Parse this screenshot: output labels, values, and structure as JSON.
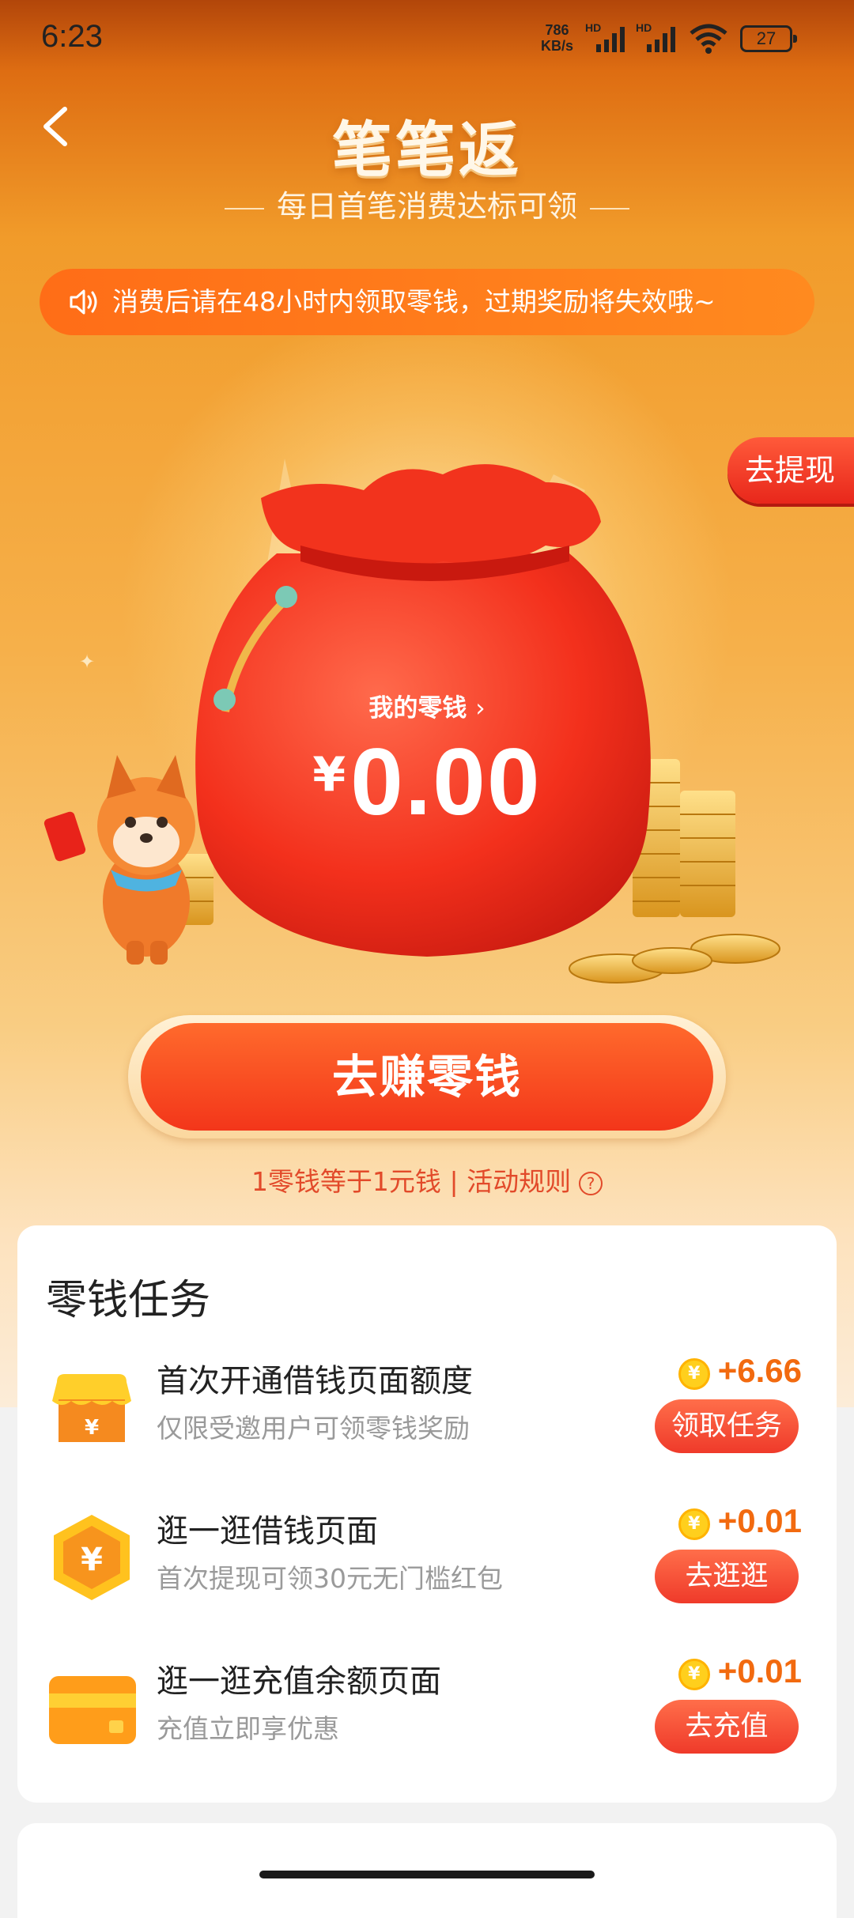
{
  "status_bar": {
    "time": "6:23",
    "net_speed": "786",
    "net_unit": "KB/s",
    "hd1": "HD",
    "hd2": "HD",
    "battery": "27"
  },
  "header": {
    "title": "笔笔返",
    "subtitle": "每日首笔消费达标可领"
  },
  "notice": {
    "text": "消费后请在48小时内领取零钱，过期奖励将失效哦~"
  },
  "side_button": {
    "label": "去提现"
  },
  "wallet": {
    "label": "我的零钱",
    "currency": "¥",
    "amount": "0.00"
  },
  "earn_button": {
    "label": "去赚零钱"
  },
  "rules": {
    "exchange": "1零钱等于1元钱",
    "separator": "|",
    "rules_link": "活动规则",
    "help": "?"
  },
  "tasks_card": {
    "title": "零钱任务",
    "tasks": [
      {
        "name": "首次开通借钱页面额度",
        "desc": "仅限受邀用户可领零钱奖励",
        "reward": "+6.66",
        "button": "领取任务",
        "icon": "shop-icon"
      },
      {
        "name": "逛一逛借钱页面",
        "desc": "首次提现可领30元无门槛红包",
        "reward": "+0.01",
        "button": "去逛逛",
        "icon": "yuan-hexagon-icon"
      },
      {
        "name": "逛一逛充值余额页面",
        "desc": "充值立即享优惠",
        "reward": "+0.01",
        "button": "去充值",
        "icon": "card-icon"
      }
    ]
  },
  "colors": {
    "accent": "#f3361a",
    "reward": "#f26a0f",
    "notice_bg": "#ff7a1c"
  }
}
